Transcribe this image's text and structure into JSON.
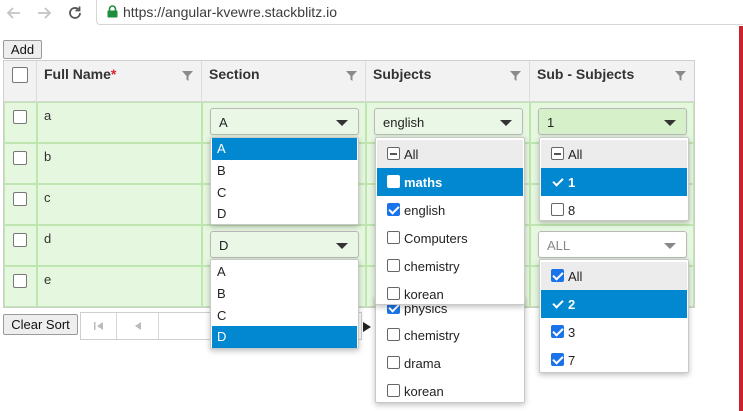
{
  "browser": {
    "url": "https://angular-kvewre.stackblitz.io",
    "back_icon": "arrow-left",
    "forward_icon": "arrow-right",
    "reload_icon": "reload",
    "lock_icon": "lock"
  },
  "toolbar": {
    "add_label": "Add",
    "clear_sort_label": "Clear Sort"
  },
  "grid": {
    "columns": [
      {
        "key": "full_name",
        "label": "Full Name",
        "required_mark": "*"
      },
      {
        "key": "section",
        "label": "Section"
      },
      {
        "key": "subjects",
        "label": "Subjects"
      },
      {
        "key": "sub_subjects",
        "label": "Sub - Subjects"
      }
    ],
    "rows": [
      {
        "name": "a",
        "section": "A",
        "subjects": "english",
        "sub_subjects": "1"
      },
      {
        "name": "b"
      },
      {
        "name": "c"
      },
      {
        "name": "d",
        "section": "D",
        "sub_subjects_placeholder": "ALL"
      },
      {
        "name": "e"
      }
    ]
  },
  "section_dropdown_1": {
    "options": [
      "A",
      "B",
      "C",
      "D"
    ],
    "highlighted": "A"
  },
  "section_dropdown_2": {
    "options": [
      "A",
      "B",
      "C",
      "D"
    ],
    "highlighted": "D"
  },
  "subjects_dropdown": {
    "all_label": "All",
    "options": [
      {
        "label": "maths",
        "checked": false,
        "highlighted": true
      },
      {
        "label": "english",
        "checked": true
      },
      {
        "label": "Computers",
        "checked": false
      },
      {
        "label": "chemistry",
        "checked": false
      },
      {
        "label": "korean",
        "checked": false
      }
    ]
  },
  "subjects_dropdown_behind": {
    "options": [
      {
        "label": "physics",
        "checked": true
      },
      {
        "label": "chemistry",
        "checked": false
      },
      {
        "label": "drama",
        "checked": false
      },
      {
        "label": "korean",
        "checked": false
      }
    ]
  },
  "sub_subjects_dropdown_1": {
    "all_label": "All",
    "options": [
      {
        "label": "1",
        "checked": true,
        "highlighted": true
      },
      {
        "label": "8",
        "checked": false
      }
    ]
  },
  "sub_subjects_dropdown_2": {
    "all_label": "All",
    "options": [
      {
        "label": "2",
        "checked": true,
        "highlighted": true
      },
      {
        "label": "3",
        "checked": true
      },
      {
        "label": "7",
        "checked": true
      }
    ]
  },
  "colors": {
    "highlight": "#0288d1",
    "row_bg": "#e6f7df",
    "row_border": "#bfe6b0",
    "required": "#d9232d",
    "side_accent": "#c8242a"
  }
}
